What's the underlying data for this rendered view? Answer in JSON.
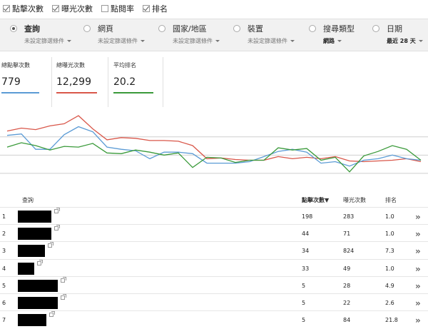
{
  "metrics": [
    {
      "label": "點擊次數",
      "checked": true
    },
    {
      "label": "曝光次數",
      "checked": true
    },
    {
      "label": "點閱率",
      "checked": false
    },
    {
      "label": "排名",
      "checked": true
    }
  ],
  "filters": [
    {
      "title": "查詢",
      "sub": "未設定篩選條件",
      "selected": true
    },
    {
      "title": "網頁",
      "sub": "未設定篩選條件",
      "selected": false
    },
    {
      "title": "國家/地區",
      "sub": "未設定篩選條件",
      "selected": false
    },
    {
      "title": "裝置",
      "sub": "未設定篩選條件",
      "selected": false
    },
    {
      "title": "搜尋類型",
      "sub": "網路",
      "selected": false
    },
    {
      "title": "日期",
      "sub": "最近 28 天",
      "selected": false
    }
  ],
  "cards": [
    {
      "label": "總點擊次數",
      "value": "779",
      "color": "#5b9bd5"
    },
    {
      "label": "總曝光次數",
      "value": "12,299",
      "color": "#d9574a"
    },
    {
      "label": "平均排名",
      "value": "20.2",
      "color": "#3a9a3a"
    }
  ],
  "chart_data": {
    "type": "line",
    "grid": true,
    "series": [
      {
        "color": "#d9574a",
        "values": [
          38,
          42,
          40,
          45,
          48,
          59,
          41,
          26,
          29,
          28,
          25,
          25,
          24,
          18,
          0,
          1,
          -1,
          -2,
          -2,
          3,
          0,
          2,
          0,
          3,
          -3,
          -4,
          -3,
          -2,
          0,
          -4
        ]
      },
      {
        "color": "#5b9bd5",
        "values": [
          32,
          34,
          13,
          13,
          33,
          44,
          37,
          16,
          13,
          11,
          0,
          9,
          9,
          7,
          -6,
          -6,
          -6,
          -4,
          3,
          10,
          13,
          9,
          -6,
          -4,
          -10,
          -2,
          0,
          5,
          0,
          -2
        ]
      },
      {
        "color": "#3a9a3a",
        "values": [
          16,
          22,
          18,
          12,
          17,
          16,
          21,
          8,
          7,
          12,
          9,
          5,
          8,
          -12,
          2,
          1,
          -5,
          -2,
          -2,
          15,
          12,
          14,
          -2,
          2,
          -18,
          4,
          10,
          18,
          13,
          -2
        ]
      }
    ]
  },
  "table": {
    "headers": {
      "query": "查詢",
      "clicks": "點擊次數▼",
      "impressions": "曝光次數",
      "position": "排名"
    },
    "rows": [
      {
        "index": "1",
        "clicks": "198",
        "impressions": "283",
        "position": "1.0",
        "redact_width": 47
      },
      {
        "index": "2",
        "clicks": "44",
        "impressions": "71",
        "position": "1.0",
        "redact_width": 47
      },
      {
        "index": "3",
        "clicks": "34",
        "impressions": "824",
        "position": "7.3",
        "redact_width": 38
      },
      {
        "index": "4",
        "clicks": "33",
        "impressions": "49",
        "position": "1.0",
        "redact_width": 23
      },
      {
        "index": "5",
        "clicks": "5",
        "impressions": "28",
        "position": "4.9",
        "redact_width": 56
      },
      {
        "index": "6",
        "clicks": "5",
        "impressions": "22",
        "position": "2.6",
        "redact_width": 56
      },
      {
        "index": "7",
        "clicks": "5",
        "impressions": "84",
        "position": "21.8",
        "redact_width": 40
      }
    ]
  },
  "chevron": "»"
}
